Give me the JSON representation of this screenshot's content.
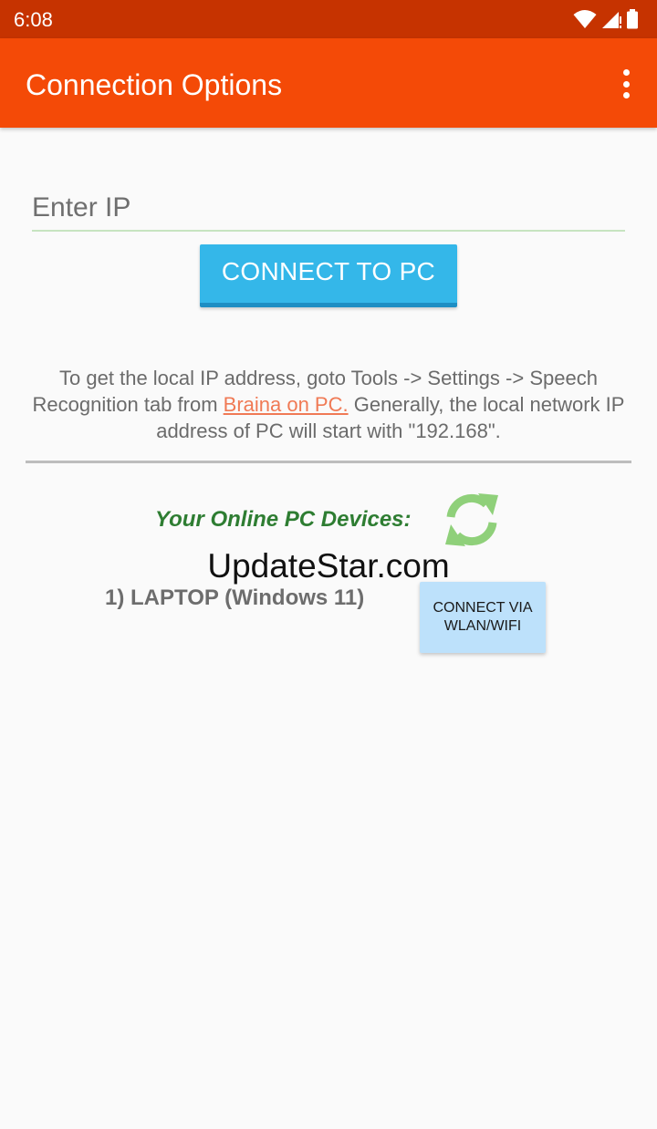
{
  "status_bar": {
    "time": "6:08",
    "icons": [
      "wifi-icon",
      "signal-icon",
      "battery-icon"
    ]
  },
  "app_bar": {
    "title": "Connection Options",
    "menu_icon": "more-vert-icon"
  },
  "ip_form": {
    "placeholder": "Enter IP",
    "value": "",
    "connect_label": "CONNECT TO PC"
  },
  "info": {
    "text_before": "To get the local IP address, goto Tools -> Settings -> Speech Recognition tab from ",
    "link_text": "Braina on PC.",
    "text_after": " Generally, the local network IP address of PC will start with \"192.168\"."
  },
  "devices": {
    "heading": "Your Online PC Devices:",
    "refresh_icon": "refresh-icon",
    "items": [
      {
        "label": "1) LAPTOP (Windows 11)",
        "button_label": "CONNECT VIA WLAN/WIFI"
      }
    ]
  },
  "watermark": "UpdateStar.com",
  "colors": {
    "status_bar": "#c63300",
    "app_bar": "#f44a07",
    "connect_button": "#34b7e9",
    "link": "#f07a55",
    "heading_green": "#2e7d32",
    "refresh_green": "#8fd07a",
    "wifi_button": "#bde1fb"
  }
}
